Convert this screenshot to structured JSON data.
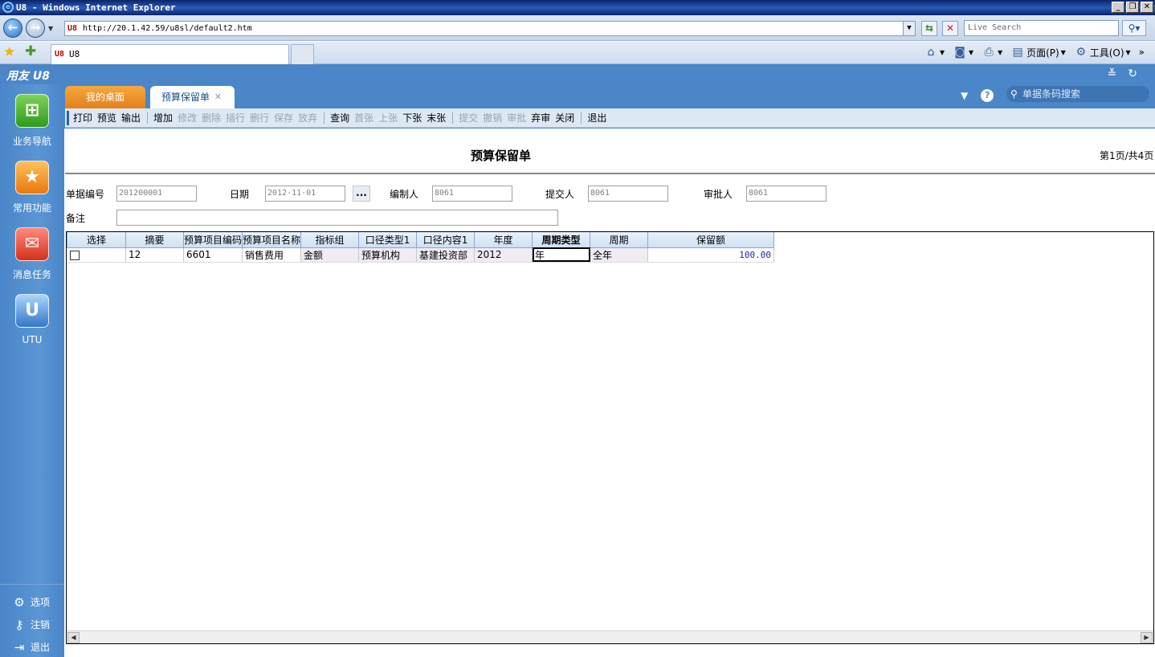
{
  "browser": {
    "title": "U8 - Windows Internet Explorer",
    "url": "http://20.1.42.59/u8sl/default2.htm",
    "search_placeholder": "Live Search",
    "tab_label": "U8",
    "cmd_page": "页面(P)",
    "cmd_tools": "工具(O)",
    "cmd_more": "»"
  },
  "app": {
    "logo": "用友 U8",
    "tabs": [
      {
        "label": "我的桌面"
      },
      {
        "label": "预算保留单"
      }
    ],
    "search_placeholder": "单据条码搜索"
  },
  "toolbar": {
    "items": [
      {
        "label": "打印",
        "enabled": true
      },
      {
        "label": "预览",
        "enabled": true
      },
      {
        "label": "输出",
        "enabled": true
      },
      {
        "label": "增加",
        "enabled": true
      },
      {
        "label": "修改",
        "enabled": false
      },
      {
        "label": "删除",
        "enabled": false
      },
      {
        "label": "插行",
        "enabled": false
      },
      {
        "label": "删行",
        "enabled": false
      },
      {
        "label": "保存",
        "enabled": false
      },
      {
        "label": "放弃",
        "enabled": false
      },
      {
        "label": "查询",
        "enabled": true
      },
      {
        "label": "首张",
        "enabled": false
      },
      {
        "label": "上张",
        "enabled": false
      },
      {
        "label": "下张",
        "enabled": true
      },
      {
        "label": "末张",
        "enabled": true
      },
      {
        "label": "提交",
        "enabled": false
      },
      {
        "label": "撤销",
        "enabled": false
      },
      {
        "label": "审批",
        "enabled": false
      },
      {
        "label": "弃审",
        "enabled": true
      },
      {
        "label": "关闭",
        "enabled": true
      },
      {
        "label": "退出",
        "enabled": true
      }
    ]
  },
  "sidebar": {
    "items": [
      {
        "label": "业务导航"
      },
      {
        "label": "常用功能"
      },
      {
        "label": "消息任务"
      },
      {
        "label": "UTU"
      }
    ],
    "bottom": [
      {
        "label": "选项"
      },
      {
        "label": "注销"
      },
      {
        "label": "退出"
      }
    ]
  },
  "document": {
    "title": "预算保留单",
    "page_info": "第1页/共4页",
    "fields": {
      "doc_no_label": "单据编号",
      "doc_no": "201200001",
      "date_label": "日期",
      "date": "2012-11-01",
      "maker_label": "编制人",
      "maker": "8061",
      "submitter_label": "提交人",
      "submitter": "8061",
      "approver_label": "审批人",
      "approver": "8061",
      "remark_label": "备注",
      "remark": "",
      "dots": "..."
    },
    "grid": {
      "headers": [
        "选择",
        "摘要",
        "预算项目编码",
        "预算项目名称",
        "指标组",
        "口径类型1",
        "口径内容1",
        "年度",
        "周期类型",
        "周期",
        "保留额"
      ],
      "rows": [
        {
          "select": false,
          "summary": "12",
          "item_code": "6601",
          "item_name": "销售费用",
          "indicator_group": "金额",
          "scope_type": "预算机构",
          "scope_content": "基建投资部",
          "year": "2012",
          "period_type": "年",
          "period": "全年",
          "amount": "100.00"
        }
      ]
    }
  }
}
